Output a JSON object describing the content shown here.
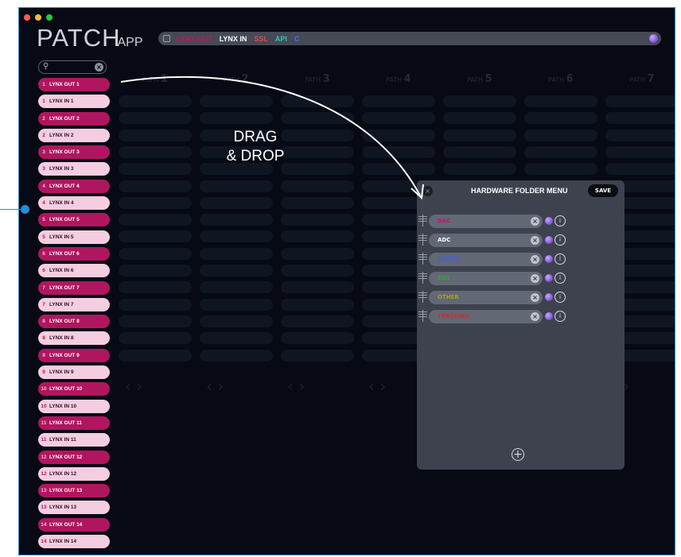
{
  "app": {
    "logo_big": "PATCH",
    "logo_small": "APP"
  },
  "tabs": [
    {
      "label": "LYNX OUT",
      "color": "#c0156a"
    },
    {
      "label": "LYNX IN",
      "color": "#ffffff"
    },
    {
      "label": "SSL",
      "color": "#e8434a"
    },
    {
      "label": "API",
      "color": "#2fc4c4"
    },
    {
      "label": "C",
      "color": "#4b6cf0"
    }
  ],
  "sidebar": {
    "items": [
      {
        "num": "1",
        "label": "LYNX OUT 1",
        "kind": "out"
      },
      {
        "num": "1",
        "label": "LYNX IN 1",
        "kind": "in"
      },
      {
        "num": "2",
        "label": "LYNX OUT 2",
        "kind": "out"
      },
      {
        "num": "2",
        "label": "LYNX IN 2",
        "kind": "in"
      },
      {
        "num": "3",
        "label": "LYNX OUT 3",
        "kind": "out"
      },
      {
        "num": "3",
        "label": "LYNX IN 3",
        "kind": "in"
      },
      {
        "num": "4",
        "label": "LYNX OUT 4",
        "kind": "out"
      },
      {
        "num": "4",
        "label": "LYNX IN 4",
        "kind": "in"
      },
      {
        "num": "5",
        "label": "LYNX OUT 5",
        "kind": "out"
      },
      {
        "num": "5",
        "label": "LYNX IN 5",
        "kind": "in"
      },
      {
        "num": "6",
        "label": "LYNX OUT 6",
        "kind": "out"
      },
      {
        "num": "6",
        "label": "LYNX IN 6",
        "kind": "in"
      },
      {
        "num": "7",
        "label": "LYNX OUT 7",
        "kind": "out"
      },
      {
        "num": "7",
        "label": "LYNX IN 7",
        "kind": "in"
      },
      {
        "num": "8",
        "label": "LYNX OUT 8",
        "kind": "out"
      },
      {
        "num": "8",
        "label": "LYNX IN 8",
        "kind": "in"
      },
      {
        "num": "9",
        "label": "LYNX OUT 9",
        "kind": "out"
      },
      {
        "num": "9",
        "label": "LYNX IN 9",
        "kind": "in"
      },
      {
        "num": "10",
        "label": "LYNX OUT 10",
        "kind": "out"
      },
      {
        "num": "10",
        "label": "LYNX IN 10",
        "kind": "in"
      },
      {
        "num": "11",
        "label": "LYNX OUT 11",
        "kind": "out"
      },
      {
        "num": "11",
        "label": "LYNX IN 11",
        "kind": "in"
      },
      {
        "num": "12",
        "label": "LYNX OUT 12",
        "kind": "out"
      },
      {
        "num": "12",
        "label": "LYNX IN 12",
        "kind": "in"
      },
      {
        "num": "13",
        "label": "LYNX OUT 13",
        "kind": "out"
      },
      {
        "num": "13",
        "label": "LYNX IN 13",
        "kind": "in"
      },
      {
        "num": "14",
        "label": "LYNX OUT 14",
        "kind": "out"
      },
      {
        "num": "14",
        "label": "LYNX IN 14",
        "kind": "in"
      }
    ]
  },
  "paths": [
    {
      "prefix": "PATH",
      "num": "1"
    },
    {
      "prefix": "PATH",
      "num": "2"
    },
    {
      "prefix": "PATH",
      "num": "3"
    },
    {
      "prefix": "PATH",
      "num": "4"
    },
    {
      "prefix": "PATH",
      "num": "5"
    },
    {
      "prefix": "PATH",
      "num": "6"
    },
    {
      "prefix": "PATH",
      "num": "7"
    }
  ],
  "annotation": {
    "line1": "DRAG",
    "line2": "& DROP"
  },
  "folder_menu": {
    "title": "HARDWARE FOLDER MENU",
    "save_label": "SAVE",
    "folders": [
      {
        "label": "DAC",
        "color": "#c0156a"
      },
      {
        "label": "ADC",
        "color": "#ffffff"
      },
      {
        "label": "COMPS",
        "color": "#3f5ee8"
      },
      {
        "label": "EQS",
        "color": "#2fa836"
      },
      {
        "label": "OTHER",
        "color": "#a7a31c"
      },
      {
        "label": "TRACKING",
        "color": "#d42a2a"
      }
    ]
  },
  "colors": {
    "accent_blue": "#1e8fd9",
    "lynx_out": "#b0165f",
    "lynx_in": "#f5cde0"
  },
  "icons": {
    "window_controls": [
      "close-light-icon",
      "minimize-light-icon",
      "zoom-light-icon"
    ],
    "folder_row": [
      "drag-handle-icon",
      "clear-icon",
      "color-orb-icon",
      "info-icon"
    ],
    "add": "add-circle-icon"
  }
}
